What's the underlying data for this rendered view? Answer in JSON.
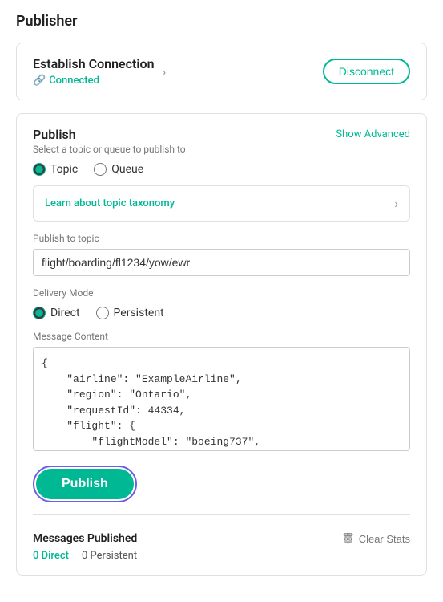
{
  "page": {
    "title": "Publisher"
  },
  "connection": {
    "title": "Establish Connection",
    "status": "Connected",
    "disconnect_label": "Disconnect"
  },
  "publish": {
    "title": "Publish",
    "subtitle": "Select a topic or queue to publish to",
    "show_advanced_label": "Show Advanced",
    "topic_label": "Topic",
    "queue_label": "Queue",
    "taxonomy_text": "Learn about topic taxonomy",
    "publish_to_topic_label": "Publish to topic",
    "publish_to_topic_value": "flight/boarding/fl1234/yow/ewr",
    "delivery_mode_label": "Delivery Mode",
    "direct_label": "Direct",
    "persistent_label": "Persistent",
    "message_content_label": "Message Content",
    "message_content_value": "{\n    \"airline\": \"ExampleAirline\",\n    \"region\": \"Ontario\",\n    \"requestId\": 44334,\n    \"flight\": {\n        \"flightModel\": \"boeing737\",",
    "publish_button_label": "Publish"
  },
  "messages": {
    "title": "Messages Published",
    "direct_count": "0 Direct",
    "persistent_count": "0 Persistent",
    "clear_stats_label": "Clear Stats"
  },
  "icons": {
    "link": "🔗",
    "chevron_right": "›",
    "trash": "🗑"
  }
}
